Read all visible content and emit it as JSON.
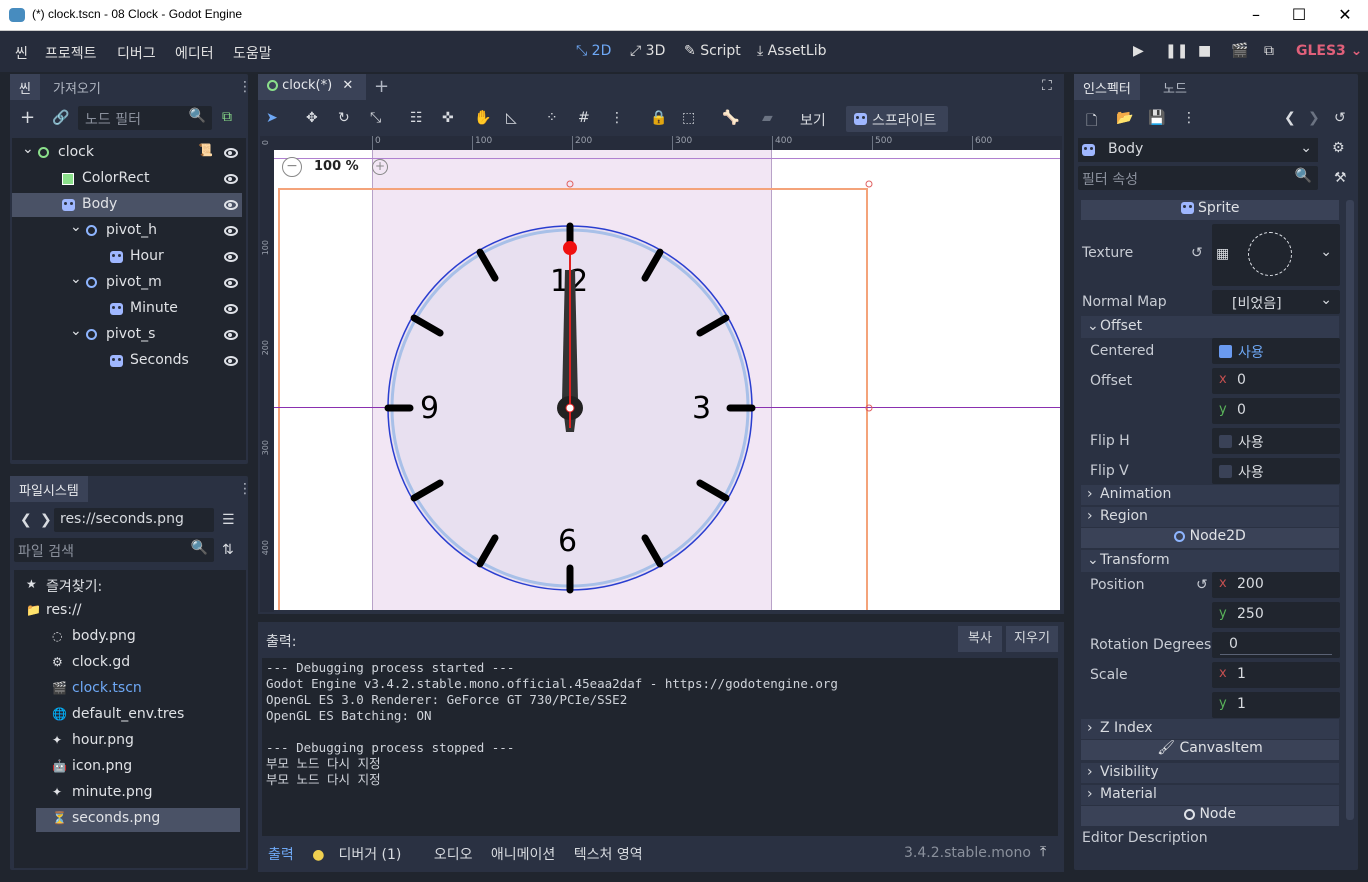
{
  "window": {
    "title": "(*) clock.tscn - 08 Clock - Godot Engine"
  },
  "menu": [
    "씬",
    "프로젝트",
    "디버그",
    "에디터",
    "도움말"
  ],
  "workspaces": {
    "d2": "2D",
    "d3": "3D",
    "script": "Script",
    "assetlib": "AssetLib"
  },
  "renderer": "GLES3",
  "scene_dock": {
    "tabs": [
      "씬",
      "가져오기"
    ],
    "filter_placeholder": "노드 필터",
    "tree": [
      {
        "name": "clock",
        "icon": "node2d-icon",
        "indent": 0
      },
      {
        "name": "ColorRect",
        "icon": "colorrect-icon",
        "indent": 1
      },
      {
        "name": "Body",
        "icon": "sprite-icon",
        "indent": 1,
        "selected": true
      },
      {
        "name": "pivot_h",
        "icon": "node2d-icon",
        "indent": 2
      },
      {
        "name": "Hour",
        "icon": "sprite-icon",
        "indent": 3
      },
      {
        "name": "pivot_m",
        "icon": "node2d-icon",
        "indent": 2
      },
      {
        "name": "Minute",
        "icon": "sprite-icon",
        "indent": 3
      },
      {
        "name": "pivot_s",
        "icon": "node2d-icon",
        "indent": 2
      },
      {
        "name": "Seconds",
        "icon": "sprite-icon",
        "indent": 3
      }
    ]
  },
  "fs_dock": {
    "tab": "파일시스템",
    "path": "res://seconds.png",
    "search_placeholder": "파일 검색",
    "favorites": "즐겨찾기:",
    "root": "res://",
    "files": [
      "body.png",
      "clock.gd",
      "clock.tscn",
      "default_env.tres",
      "hour.png",
      "icon.png",
      "minute.png",
      "seconds.png"
    ]
  },
  "editor": {
    "scene_tab": "clock(*)",
    "view_menu": "보기",
    "sprite_menu": "스프라이트",
    "zoom": "100 %",
    "ruler_h": [
      "0",
      "100",
      "200",
      "300",
      "400",
      "500",
      "600"
    ],
    "ruler_v": [
      "0",
      "100",
      "200",
      "300",
      "400"
    ],
    "clock_numbers": [
      "12",
      "3",
      "6",
      "9"
    ]
  },
  "output": {
    "title": "출력:",
    "copy": "복사",
    "clear": "지우기",
    "lines": "--- Debugging process started ---\nGodot Engine v3.4.2.stable.mono.official.45eaa2daf - https://godotengine.org\nOpenGL ES 3.0 Renderer: GeForce GT 730/PCIe/SSE2\nOpenGL ES Batching: ON\n\n--- Debugging process stopped ---\n부모 노드 다시 지정\n부모 노드 다시 지정",
    "bottom_tabs": [
      "출력",
      "디버거 (1)",
      "오디오",
      "애니메이션",
      "텍스처 영역"
    ],
    "version": "3.4.2.stable.mono"
  },
  "inspector": {
    "tabs": [
      "인스펙터",
      "노드"
    ],
    "node_name": "Body",
    "filter_placeholder": "필터 속성",
    "sprite_section": "Sprite",
    "texture": "Texture",
    "normal_map": "Normal Map",
    "normal_map_value": "[비었음]",
    "offset_group": "Offset",
    "centered": "Centered",
    "centered_value": "사용",
    "offset": "Offset",
    "offset_x": "0",
    "offset_y": "0",
    "flip_h": "Flip H",
    "flip_h_value": "사용",
    "flip_v": "Flip V",
    "flip_v_value": "사용",
    "animation": "Animation",
    "region": "Region",
    "node2d_section": "Node2D",
    "transform": "Transform",
    "position": "Position",
    "pos_x": "200",
    "pos_y": "250",
    "rotation": "Rotation Degrees",
    "rotation_value": "0",
    "scale": "Scale",
    "scale_x": "1",
    "scale_y": "1",
    "z_index": "Z Index",
    "canvasitem_section": "CanvasItem",
    "visibility": "Visibility",
    "material": "Material",
    "node_section": "Node",
    "editor_description": "Editor Description",
    "x": "x",
    "y": "y"
  }
}
